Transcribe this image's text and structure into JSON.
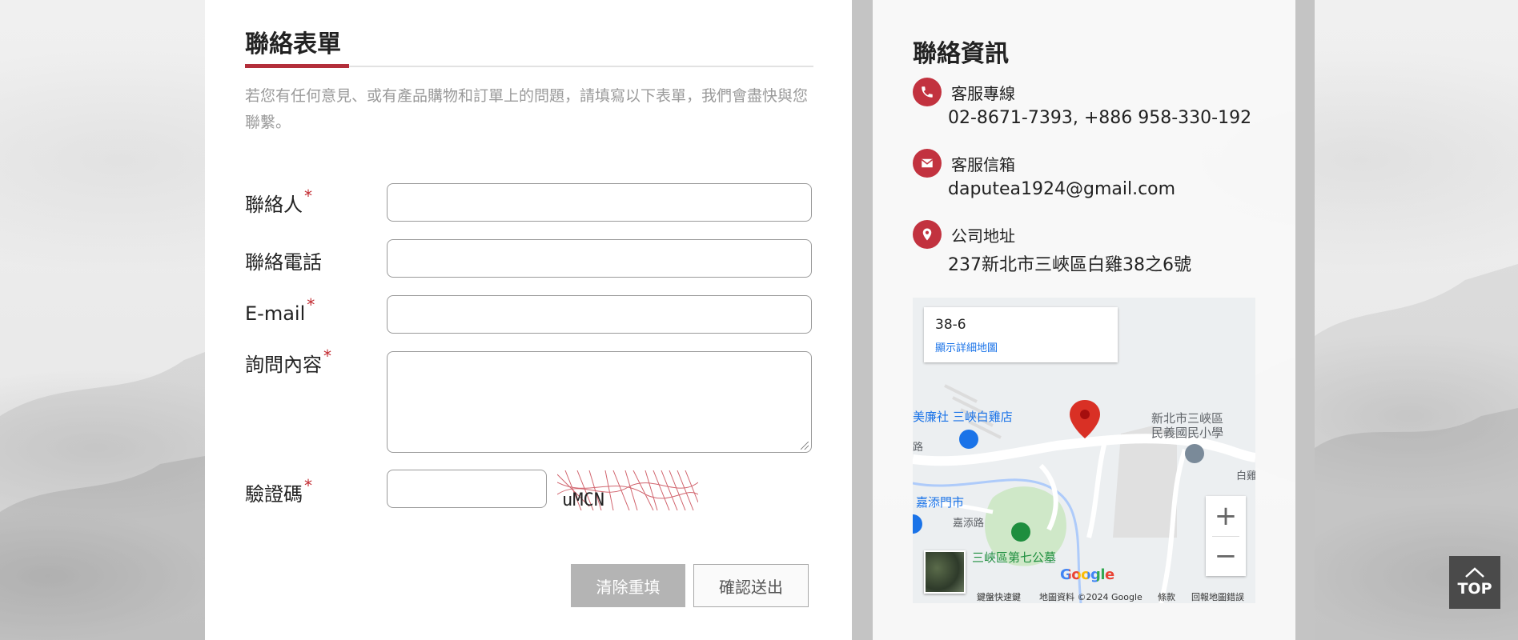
{
  "form": {
    "title": "聯絡表單",
    "intro": "若您有任何意見、或有產品購物和訂單上的問題，請填寫以下表單，我們會盡快與您聯繫。",
    "fields": [
      {
        "label": "聯絡人",
        "required": true,
        "value": "",
        "placeholder": ""
      },
      {
        "label": "聯絡電話",
        "required": false,
        "value": "",
        "placeholder": ""
      },
      {
        "label": "E-mail",
        "required": true,
        "value": "",
        "placeholder": ""
      },
      {
        "label": "詢問內容",
        "required": true,
        "value": "",
        "placeholder": ""
      },
      {
        "label": "驗證碼",
        "required": true,
        "value": "",
        "placeholder": ""
      }
    ],
    "required_mark": "*",
    "captcha_text": "uMCN",
    "clear_button": "清除重填",
    "submit_button": "確認送出"
  },
  "info": {
    "title": "聯絡資訊",
    "items": [
      {
        "icon": "phone-icon",
        "label": "客服專線",
        "value": "02-8671-7393, +886 958-330-192"
      },
      {
        "icon": "envelope-icon",
        "label": "客服信箱",
        "value": "daputea1924@gmail.com"
      },
      {
        "icon": "location-pin-icon",
        "label": "公司地址",
        "value": "237新北市三峽區白雞38之6號"
      }
    ]
  },
  "map": {
    "card_title": "38-6",
    "card_link": "顯示詳細地圖",
    "places": [
      {
        "name": "美廉社 三峽白雞店",
        "color": "#1a73e8"
      },
      {
        "name": "新北市三峽區",
        "color": "#5f6368"
      },
      {
        "name": "民義國民小學",
        "color": "#5f6368"
      },
      {
        "name": "嘉添門市",
        "color": "#1a73e8"
      },
      {
        "name": "嘉添路",
        "color": "#5f6368"
      },
      {
        "name": "三峽區第七公墓",
        "color": "#1e8e3e"
      },
      {
        "name": "白雞",
        "color": "#5f6368"
      },
      {
        "name": "路",
        "color": "#5f6368"
      }
    ],
    "zoom_in": "+",
    "zoom_out": "−",
    "logo": "Google",
    "footer": {
      "shortcuts": "鍵盤快速鍵",
      "data": "地圖資料 ©2024 Google",
      "terms": "條款",
      "report": "回報地圖錯誤"
    },
    "pin_color": "#d93025"
  },
  "top_button": {
    "label": "TOP"
  },
  "colors": {
    "accent": "#b32e3a",
    "icon_bg": "#c2323f"
  }
}
